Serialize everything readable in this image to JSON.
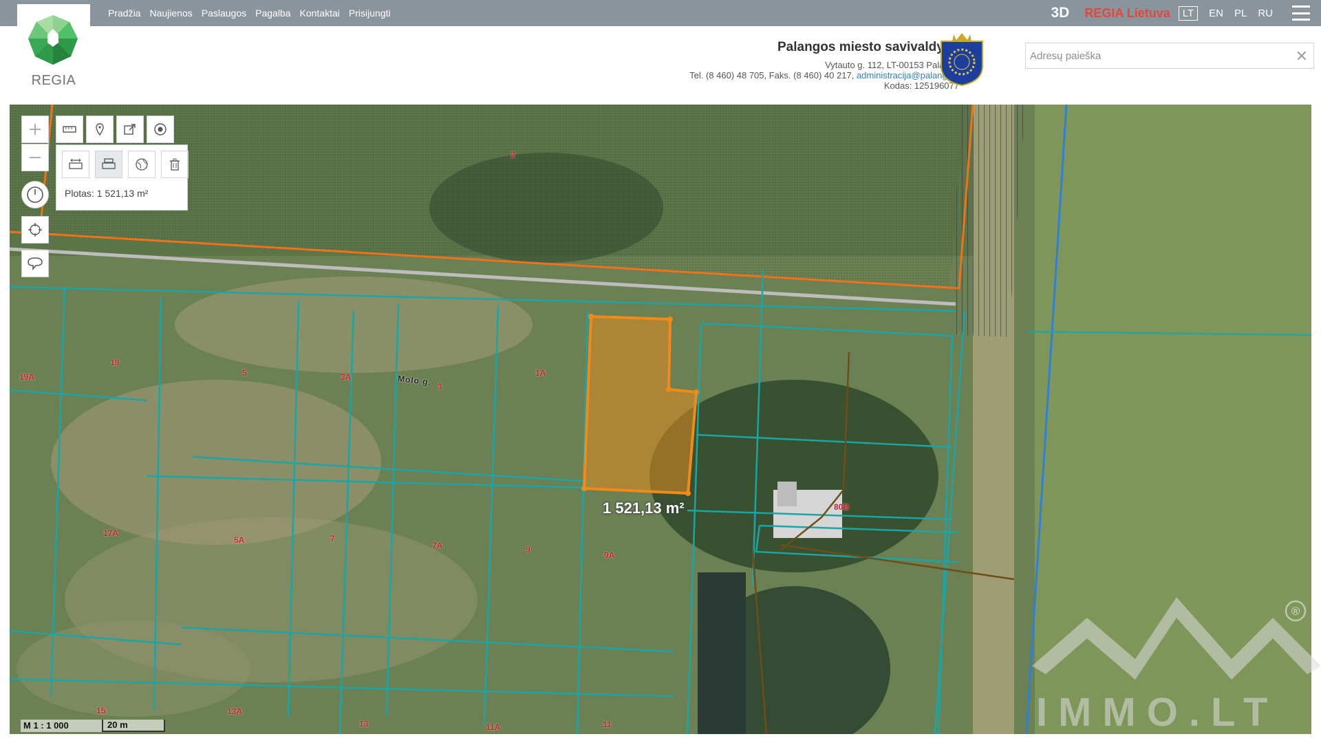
{
  "nav": {
    "items": [
      "Pradžia",
      "Naujienos",
      "Paslaugos",
      "Pagalba",
      "Kontaktai",
      "Prisijungti"
    ],
    "btn_3d": "3D",
    "regia_lietuva": "REGIA Lietuva",
    "languages": [
      "LT",
      "EN",
      "PL",
      "RU"
    ],
    "active_language": "LT"
  },
  "logo": {
    "brand": "REGIA"
  },
  "municipality": {
    "name": "Palangos miesto savivaldybė",
    "address": "Vytauto g. 112, LT-00153 Palanga",
    "phone": "Tel. (8 460) 48 705, Faks. (8 460) 40 217,",
    "email": "administracija@palanga.lt",
    "code": "Kodas: 125196077"
  },
  "search": {
    "placeholder": "Adresų paieška",
    "clear": "✕"
  },
  "map": {
    "measure_area": "Plotas: 1 521,13 m²",
    "area_label": "1 521,13 m²",
    "street_name": "Molo g.",
    "scale_ratio": "M 1 : 1 000",
    "scale_bar": "20 m",
    "plots": [
      "2",
      "19A",
      "19",
      "5",
      "3A",
      "3",
      "1A",
      "17A",
      "5A",
      "7",
      "7A",
      "9",
      "9A",
      "80B",
      "15",
      "13A",
      "13",
      "11A",
      "11"
    ],
    "watermark": "IMMO.LT",
    "watermark_mark": "®"
  },
  "colors": {
    "topbar": "#8a949d",
    "parcel_line": "#1ba5a5",
    "selection": "#f28a1a",
    "plot_label": "#d21c2a",
    "brand_red": "#e2473b"
  }
}
